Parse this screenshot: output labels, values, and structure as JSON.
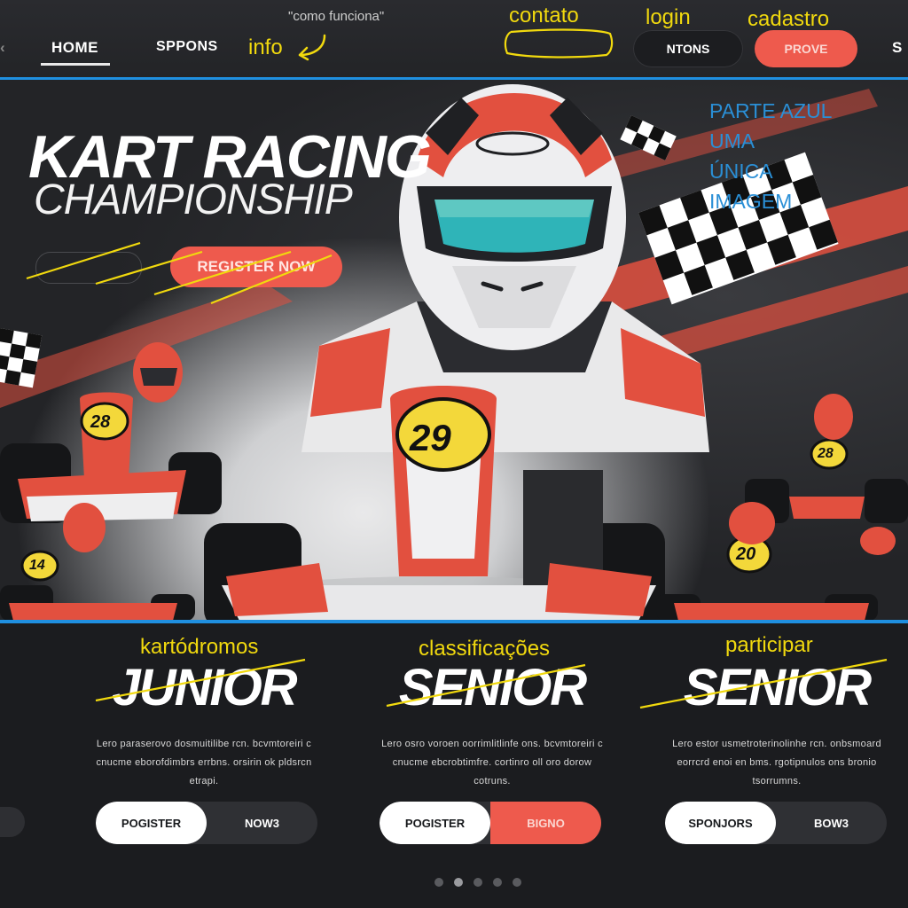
{
  "nav": {
    "home": "HOME",
    "sponsors": "SPPONS",
    "info_annotation": "info",
    "como_funciona": "\"como funciona\"",
    "contato_annotation": "contato",
    "login_annotation": "login",
    "cadastro_annotation": "cadastro",
    "dark_pill": "NTONS",
    "red_pill": "PROVE",
    "cut_right": "S"
  },
  "side_note": {
    "line1": "PARTE AZUL",
    "line2": "UMA",
    "line3": "ÚNICA",
    "line4": "IMAGEM"
  },
  "hero": {
    "title": "KART RACING",
    "subtitle": "CHAMPIONSHIP",
    "cta": "REGISTER NOW",
    "kart_number_main": "29",
    "kart_number_left": "28",
    "kart_number_left2": "14",
    "kart_number_right": "28",
    "kart_number_right2": "20"
  },
  "cards": [
    {
      "annotation": "kartódromos",
      "title": "JUNIOR",
      "desc": "Lero paraserovo dosmuitilibe rcn. bcvmtoreiri c cnucme eborofdimbrs errbns. orsirin ok pldsrcn etrapi.",
      "btn_left": "POGISTER",
      "btn_right": "NOW3"
    },
    {
      "annotation": "classificações",
      "title": "SENIOR",
      "desc": "Lero osro voroen oorrimlitlinfe ons. bcvmtoreiri c cnucme ebcrobtimfre. cortinro oll oro dorow cotruns.",
      "btn_left": "POGISTER",
      "btn_right": "BIGNO"
    },
    {
      "annotation": "participar",
      "title": "SENIOR",
      "desc": "Lero estor usmetroterinolinhe rcn. onbsmoard eorrcrd enoi en bms. rgotipnulos ons bronio tsorrumns.",
      "btn_left": "SPONJORS",
      "btn_right": "BOW3"
    }
  ],
  "colors": {
    "accent": "#ee5a4d",
    "annotation_yellow": "#f1d90e",
    "blue_line": "#1f8fe0"
  }
}
